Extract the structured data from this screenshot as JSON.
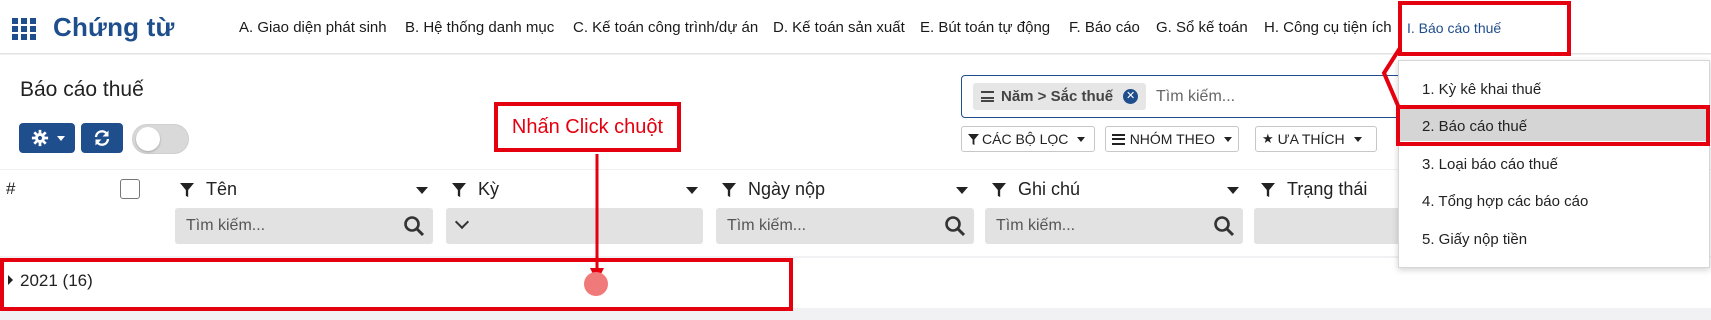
{
  "navbar": {
    "brand": "Chứng từ",
    "menu": [
      "A. Giao diện phát sinh",
      "B. Hệ thống danh mục",
      "C. Kế toán công trình/dự án",
      "D. Kế toán sản xuất",
      "E. Bút toán tự động",
      "F. Báo cáo",
      "G. Sổ kế toán",
      "H. Công cụ tiện ích",
      "I. Báo cáo thuế"
    ],
    "active_menu": "I. Báo cáo thuế"
  },
  "control_panel": {
    "title": "Báo cáo thuế",
    "search": {
      "facet": "Năm > Sắc thuế",
      "placeholder": "Tìm kiếm..."
    },
    "filters_label": "CÁC BỘ LỌC",
    "group_by_label": "NHÓM THEO",
    "favorites_label": "ƯA THÍCH"
  },
  "list": {
    "hash_header": "#",
    "columns": [
      "Tên",
      "Kỳ",
      "Ngày nộp",
      "Ghi chú",
      "Trạng thái"
    ],
    "filter_placeholder": "Tìm kiếm...",
    "groups": [
      {
        "label": "2021 (16)"
      }
    ]
  },
  "dropdown_menu": {
    "items": [
      "1. Kỳ kê khai thuế",
      "2. Báo cáo thuế",
      "3. Loại báo cáo thuế",
      "4. Tổng hợp các báo cáo",
      "5. Giấy nộp tiền"
    ],
    "highlighted": "2. Báo cáo thuế"
  },
  "annotation": {
    "callout": "Nhấn Click chuột",
    "color": "#e5000f"
  },
  "colors": {
    "primary": "#1f4e8c",
    "annotation_red": "#e5000f"
  }
}
